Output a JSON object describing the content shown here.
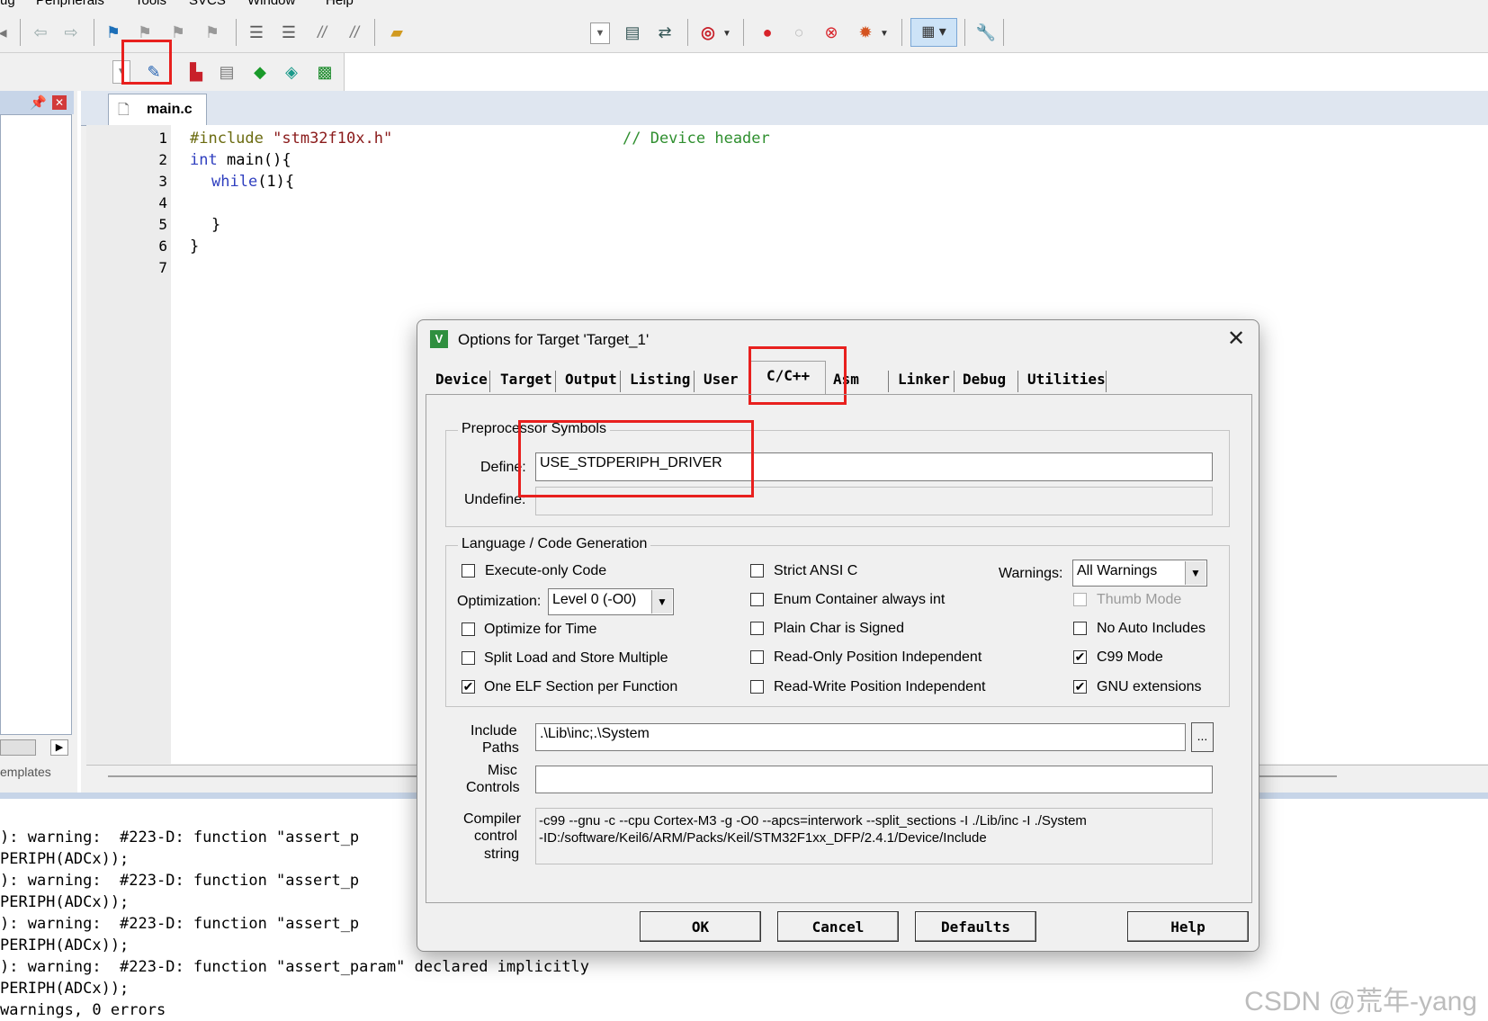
{
  "menu": {
    "items": [
      "ug",
      "Peripherals",
      "Tools",
      "SVCS",
      "Window",
      "Help"
    ]
  },
  "toolbar": {
    "icons": [
      "left-arrow-icon",
      "back-icon",
      "forward-icon",
      "bookmark-icon",
      "bookmark-prev-icon",
      "bookmark-next-icon",
      "bookmark-clear-icon",
      "indent-icon",
      "unindent-icon",
      "comment-icon",
      "uncomment-icon",
      "open-folder-icon",
      "combo-dropdown-icon",
      "find-icon",
      "find-replace-icon",
      "debug-icon",
      "breakpoint-icon",
      "breakpoint-disable-icon",
      "breakpoint-kill-icon",
      "breakpoint-all-icon",
      "window-layout-icon",
      "wrench-icon"
    ],
    "icons2": [
      "target-select-icon",
      "options-for-target-icon",
      "pack-installer-icon",
      "manage-components-icon",
      "manage-rte-icon",
      "pack-icon",
      "select-software-icon"
    ]
  },
  "project_pane": {
    "tab_label": "emplates"
  },
  "editor": {
    "file_tab": "main.c",
    "line_numbers": [
      "1",
      "2",
      "3",
      "4",
      "5",
      "6",
      "7"
    ],
    "lines": [
      {
        "pre": "#include",
        "str": " \"stm32f10x.h\"",
        "comment": "// Device header"
      },
      {
        "kw": "int",
        "rest": " main(){"
      },
      {
        "kw": "while",
        "rest": "(1){"
      },
      {
        "text": ""
      },
      {
        "text": "}"
      },
      {
        "text": "}"
      },
      {
        "text": ""
      }
    ]
  },
  "output": {
    "lines": [
      "): warning:  #223-D: function \"assert_p",
      "PERIPH(ADCx));",
      "): warning:  #223-D: function \"assert_p",
      "PERIPH(ADCx));",
      "): warning:  #223-D: function \"assert_p",
      "PERIPH(ADCx));",
      "): warning:  #223-D: function \"assert_param\" declared implicitly",
      "PERIPH(ADCx));",
      "warnings, 0 errors"
    ]
  },
  "dialog": {
    "title": "Options for Target 'Target_1'",
    "tabs": [
      "Device",
      "Target",
      "Output",
      "Listing",
      "User",
      "C/C++",
      "Asm",
      "Linker",
      "Debug",
      "Utilities"
    ],
    "active_tab": "C/C++",
    "preprocessor": {
      "group_label": "Preprocessor Symbols",
      "define_label": "Define:",
      "define_value": "USE_STDPERIPH_DRIVER",
      "undefine_label": "Undefine:",
      "undefine_value": ""
    },
    "language": {
      "group_label": "Language / Code Generation",
      "execute_only": {
        "label": "Execute-only Code",
        "checked": false
      },
      "optimization_label": "Optimization:",
      "optimization_value": "Level 0 (-O0)",
      "optimize_time": {
        "label": "Optimize for Time",
        "checked": false
      },
      "split_load": {
        "label": "Split Load and Store Multiple",
        "checked": false
      },
      "one_elf": {
        "label": "One ELF Section per Function",
        "checked": true
      },
      "strict_ansi": {
        "label": "Strict ANSI C",
        "checked": false
      },
      "enum_container": {
        "label": "Enum Container always int",
        "checked": false
      },
      "plain_char": {
        "label": "Plain Char is Signed",
        "checked": false
      },
      "ro_pi": {
        "label": "Read-Only Position Independent",
        "checked": false
      },
      "rw_pi": {
        "label": "Read-Write Position Independent",
        "checked": false
      },
      "warnings_label": "Warnings:",
      "warnings_value": "All Warnings",
      "thumb_mode": {
        "label": "Thumb Mode",
        "checked": false
      },
      "no_auto_includes": {
        "label": "No Auto Includes",
        "checked": false
      },
      "c99_mode": {
        "label": "C99 Mode",
        "checked": true
      },
      "gnu_ext": {
        "label": "GNU extensions",
        "checked": true
      }
    },
    "include_paths_label_1": "Include",
    "include_paths_label_2": "Paths",
    "include_paths_value": ".\\Lib\\inc;.\\System",
    "browse_label": "...",
    "misc_label_1": "Misc",
    "misc_label_2": "Controls",
    "misc_value": "",
    "compiler_label_1": "Compiler",
    "compiler_label_2": "control",
    "compiler_label_3": "string",
    "compiler_line_1": "-c99 --gnu -c --cpu Cortex-M3 -g -O0 --apcs=interwork --split_sections -I ./Lib/inc -I ./System",
    "compiler_line_2": "-ID:/software/Keil6/ARM/Packs/Keil/STM32F1xx_DFP/2.4.1/Device/Include",
    "buttons": {
      "ok": "OK",
      "cancel": "Cancel",
      "defaults": "Defaults",
      "help": "Help"
    },
    "close_icon": "close-icon"
  },
  "watermark": "CSDN @荒年-yang",
  "colors": {
    "highlight": "#e8201e",
    "keyword": "#2f3fbf",
    "string": "#8a1a1a",
    "comment": "#2f8f2f"
  }
}
